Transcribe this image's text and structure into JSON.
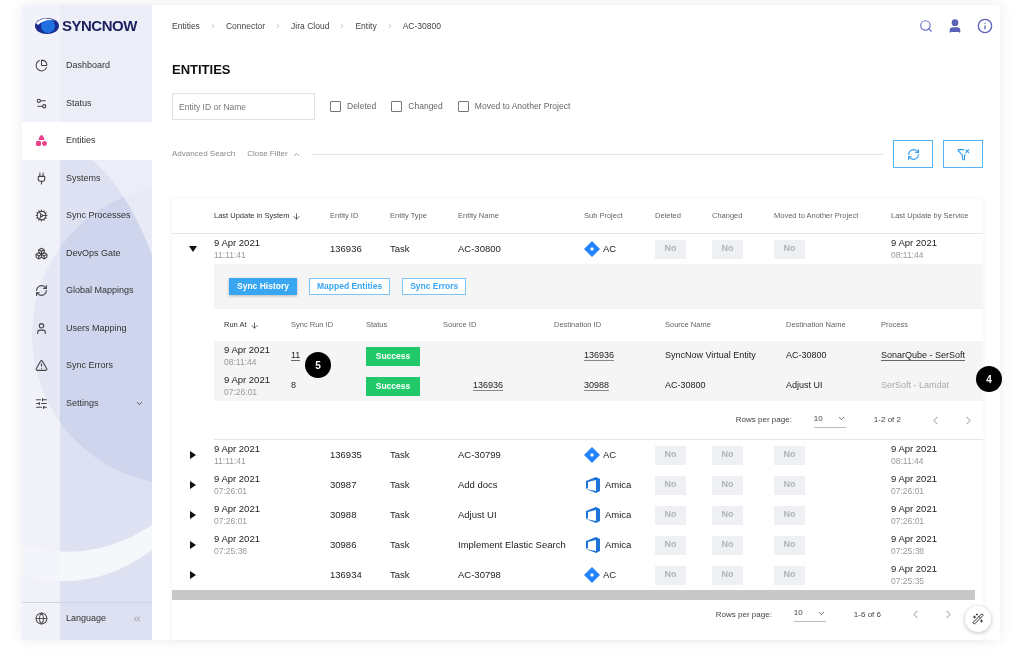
{
  "logo": {
    "text": "SYNCNOW"
  },
  "sidebar": {
    "items": [
      {
        "label": "Dashboard",
        "selected": false,
        "kind": "link"
      },
      {
        "label": "Status",
        "selected": false,
        "kind": "link"
      },
      {
        "label": "Entities",
        "selected": true,
        "kind": "link"
      },
      {
        "label": "Systems",
        "selected": false,
        "kind": "link"
      },
      {
        "label": "Sync Processes",
        "selected": false,
        "kind": "link"
      },
      {
        "label": "DevOps Gate",
        "selected": false,
        "kind": "link"
      },
      {
        "label": "Global Mappings",
        "selected": false,
        "kind": "link"
      },
      {
        "label": "Users Mapping",
        "selected": false,
        "kind": "link"
      },
      {
        "label": "Sync Errors",
        "selected": false,
        "kind": "link"
      },
      {
        "label": "Settings",
        "selected": false,
        "kind": "group"
      }
    ],
    "footer": {
      "label": "Language"
    }
  },
  "breadcrumb": [
    "Entities",
    "Connector",
    "Jira Cloud",
    "Entity",
    "AC-30800"
  ],
  "title": "ENTITIES",
  "filters": {
    "search": {
      "placeholder": "Entity ID or Name"
    },
    "checkboxes": [
      {
        "label": "Deleted",
        "checked": false
      },
      {
        "label": "Changed",
        "checked": false
      },
      {
        "label": "Moved to Another Project",
        "checked": false
      }
    ],
    "advanced_search": "Advanced Search",
    "close_filter": "Close Filter"
  },
  "table": {
    "columns": [
      {
        "label": "Last Update in System",
        "sorted": true
      },
      {
        "label": "Entity ID",
        "sorted": false
      },
      {
        "label": "Entity Type",
        "sorted": false
      },
      {
        "label": "Entity Name",
        "sorted": false
      },
      {
        "label": "Sub Project",
        "sorted": false
      },
      {
        "label": "Deleted",
        "sorted": false
      },
      {
        "label": "Changed",
        "sorted": false
      },
      {
        "label": "Moved to Another Project",
        "sorted": false
      },
      {
        "label": "Last Update by Service",
        "sorted": false
      }
    ],
    "rows": [
      {
        "expanded": true,
        "date": "9 Apr 2021",
        "time": "11:11:41",
        "entity_id": "136936",
        "entity_type": "Task",
        "entity_name": "AC-30800",
        "sub_project": {
          "kind": "jira",
          "name": "AC"
        },
        "deleted": "No",
        "changed": "No",
        "moved": "No",
        "service_date": "9 Apr 2021",
        "service_time": "08:11:44",
        "detail": {
          "tabs": [
            {
              "label": "Sync History",
              "selected": true
            },
            {
              "label": "Mapped Entities",
              "selected": false
            },
            {
              "label": "Sync Errors",
              "selected": false
            }
          ],
          "columns": [
            {
              "label": "Run At",
              "sorted": true
            },
            {
              "label": "Sync Run ID",
              "sorted": false
            },
            {
              "label": "Status",
              "sorted": false
            },
            {
              "label": "Source ID",
              "sorted": false
            },
            {
              "label": "Destination ID",
              "sorted": false
            },
            {
              "label": "Source Name",
              "sorted": false
            },
            {
              "label": "Destination Name",
              "sorted": false
            },
            {
              "label": "Process",
              "sorted": false
            }
          ],
          "rows": [
            {
              "date": "9 Apr 2021",
              "time": "08:11:44",
              "run_id": {
                "text": "11",
                "link": true
              },
              "status": "Success",
              "destination_id": "136936",
              "source_name": "SyncNow Virtual Entity",
              "destination_name": "AC-30800",
              "process": {
                "text": "SonarQube - SerSoft",
                "disabled": false
              }
            },
            {
              "date": "9 Apr 2021",
              "time": "07:26:01",
              "run_id": {
                "text": "8",
                "link": false
              },
              "status": "Success",
              "source_id": "136936",
              "destination_id": "30988",
              "source_name": "AC-30800",
              "destination_name": "Adjust UI",
              "process": {
                "text": "SerSoft - Lamdat",
                "disabled": true
              }
            }
          ],
          "pagination": {
            "label": "Rows per page:",
            "rows_per_page": "10",
            "range": "1-2 of 2"
          }
        }
      },
      {
        "expanded": false,
        "date": "9 Apr 2021",
        "time": "11:11:41",
        "entity_id": "136935",
        "entity_type": "Task",
        "entity_name": "AC-30799",
        "sub_project": {
          "kind": "jira",
          "name": "AC"
        },
        "deleted": "No",
        "changed": "No",
        "moved": "No",
        "service_date": "9 Apr 2021",
        "service_time": "08:11:44"
      },
      {
        "expanded": false,
        "date": "9 Apr 2021",
        "time": "07:26:01",
        "entity_id": "30987",
        "entity_type": "Task",
        "entity_name": "Add docs",
        "sub_project": {
          "kind": "azure",
          "name": "Amica"
        },
        "deleted": "No",
        "changed": "No",
        "moved": "No",
        "service_date": "9 Apr 2021",
        "service_time": "07:26:01"
      },
      {
        "expanded": false,
        "date": "9 Apr 2021",
        "time": "07:26:01",
        "entity_id": "30988",
        "entity_type": "Task",
        "entity_name": "Adjust UI",
        "sub_project": {
          "kind": "azure",
          "name": "Amica"
        },
        "deleted": "No",
        "changed": "No",
        "moved": "No",
        "service_date": "9 Apr 2021",
        "service_time": "07:26:01"
      },
      {
        "expanded": false,
        "date": "9 Apr 2021",
        "time": "07:25:38",
        "entity_id": "30986",
        "entity_type": "Task",
        "entity_name": "Implement Elastic Search",
        "sub_project": {
          "kind": "azure",
          "name": "Amica"
        },
        "deleted": "No",
        "changed": "No",
        "moved": "No",
        "service_date": "9 Apr 2021",
        "service_time": "07:25:38"
      },
      {
        "expanded": false,
        "entity_id": "136934",
        "entity_type": "Task",
        "entity_name": "AC-30798",
        "sub_project": {
          "kind": "jira",
          "name": "AC"
        },
        "deleted": "No",
        "changed": "No",
        "moved": "No",
        "service_date": "9 Apr 2021",
        "service_time": "07:25:35"
      }
    ],
    "pagination": {
      "label": "Rows per page:",
      "rows_per_page": "10",
      "range": "1-6 of 6"
    }
  },
  "callouts": [
    {
      "text": "5"
    },
    {
      "text": "4"
    }
  ]
}
